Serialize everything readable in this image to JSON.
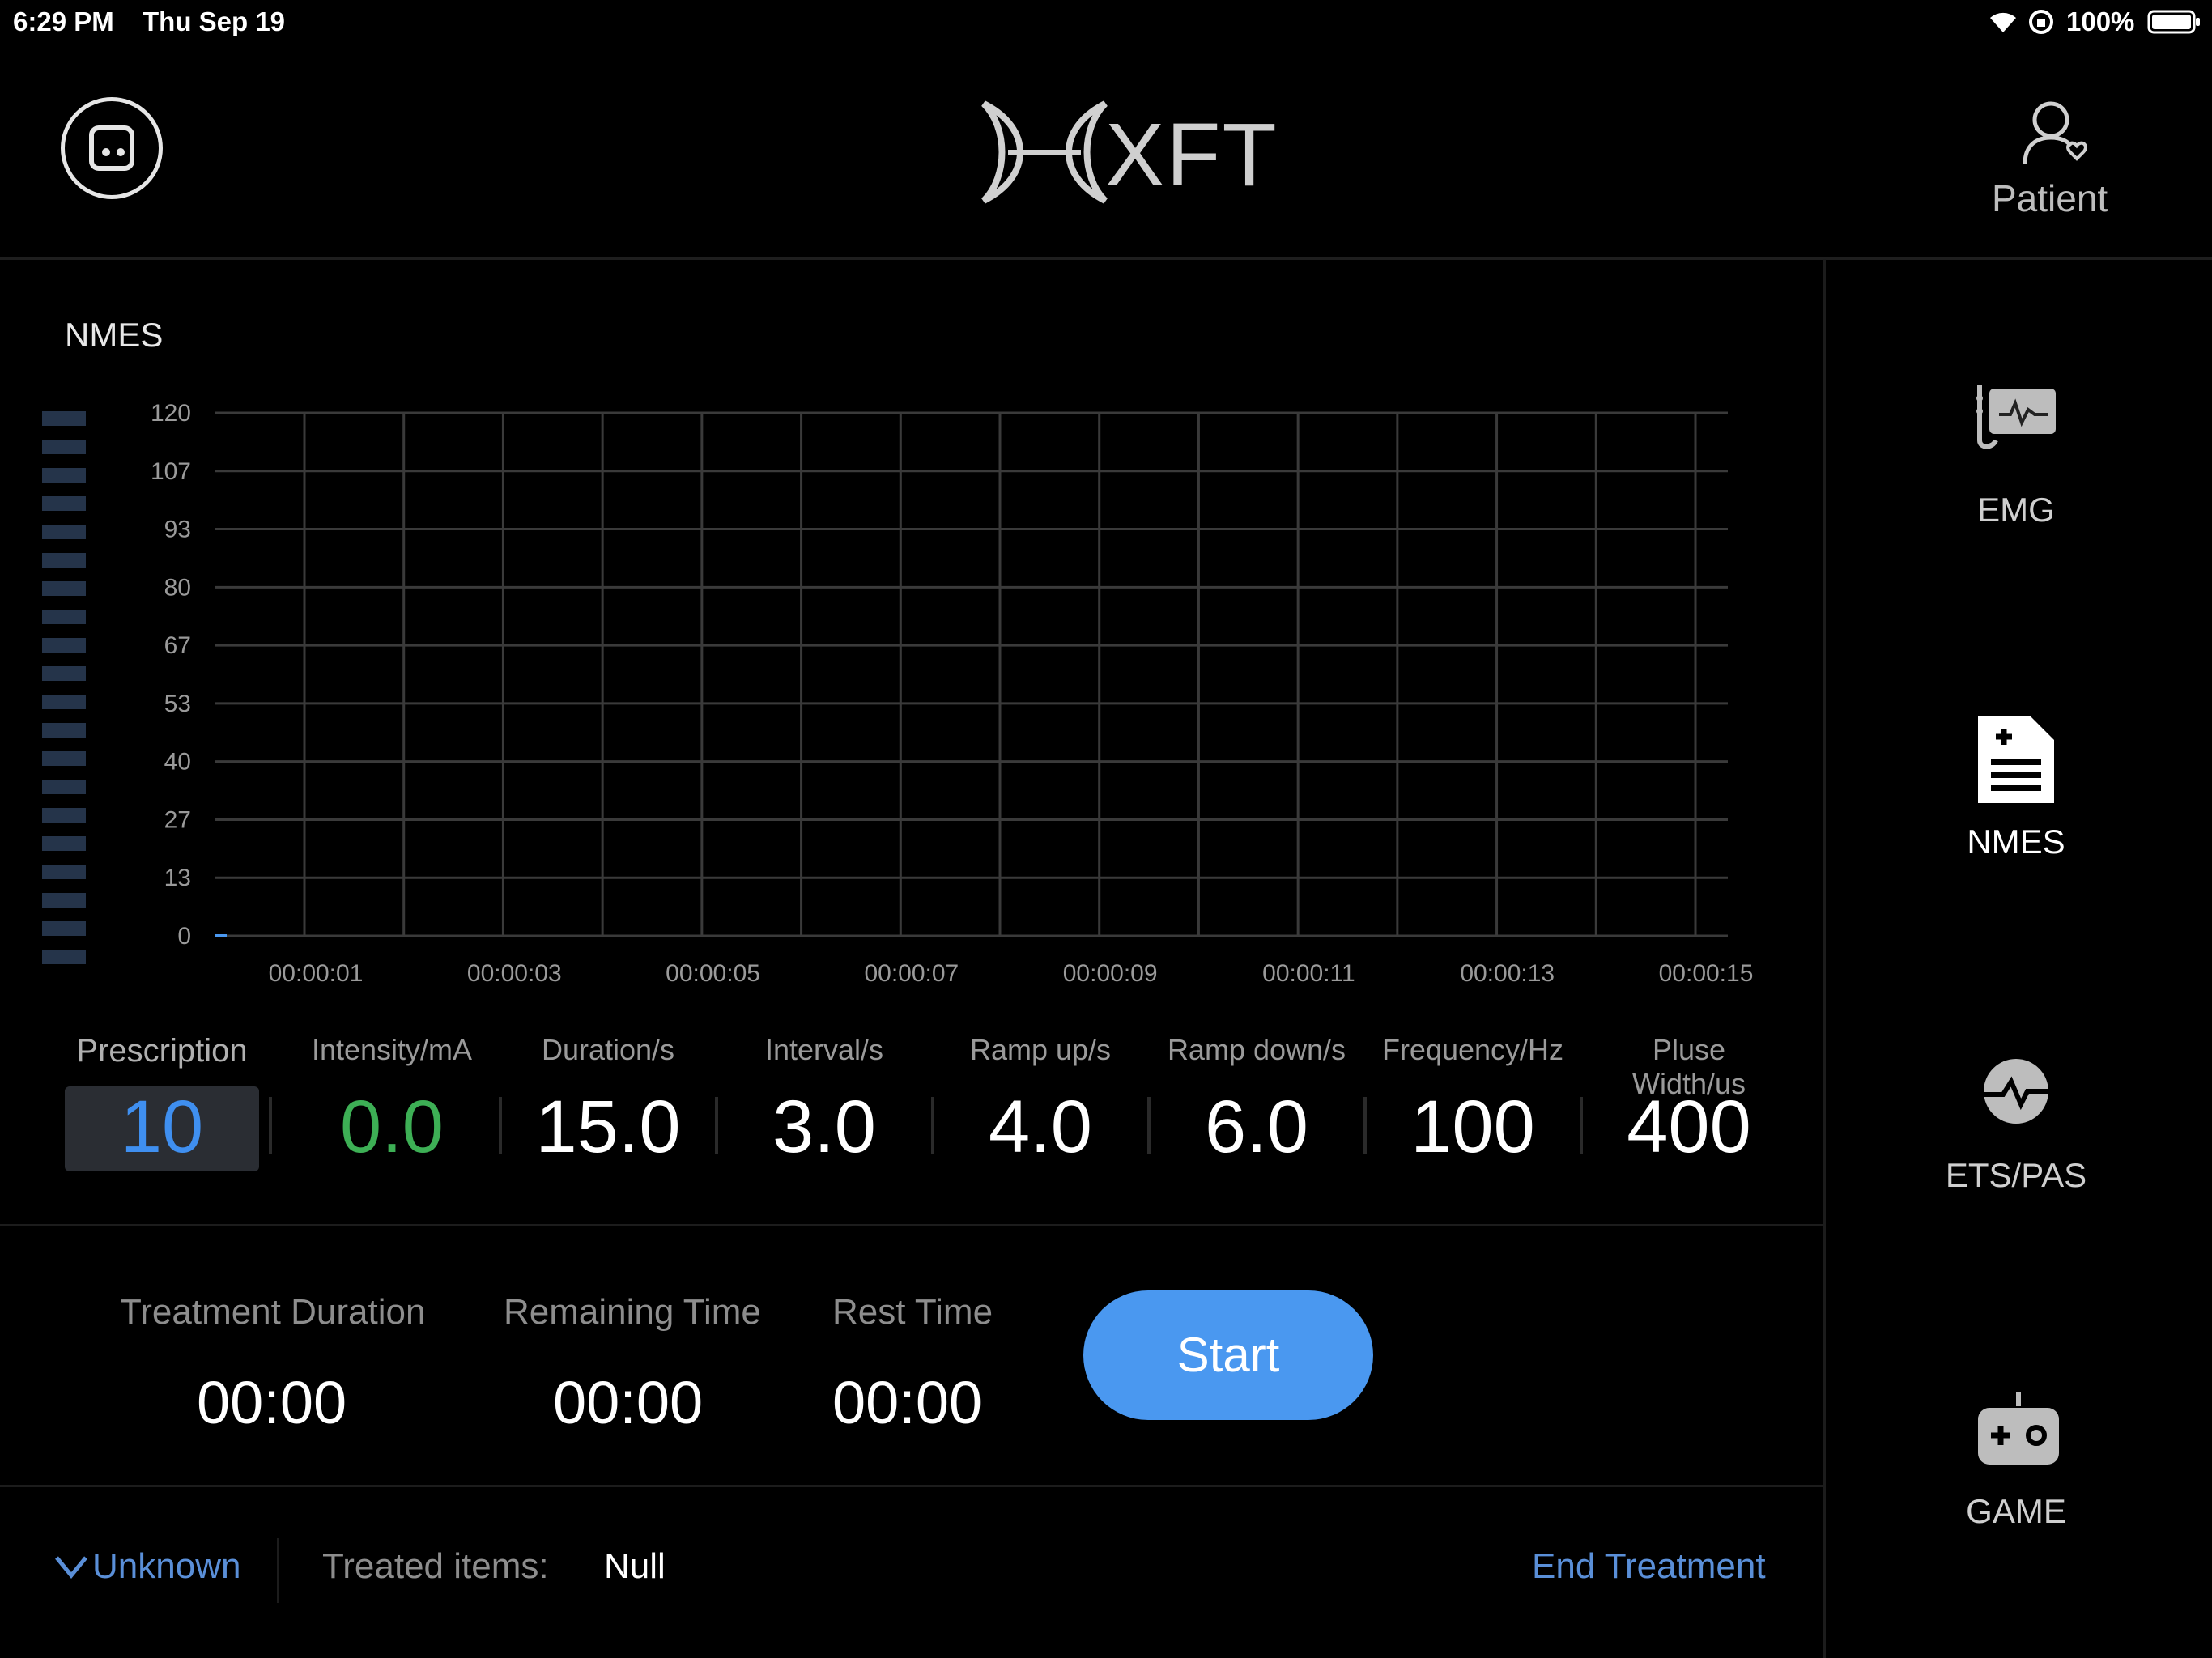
{
  "status_bar": {
    "time": "6:29 PM",
    "date": "Thu Sep 19",
    "battery": "100%"
  },
  "header": {
    "logo_text": "XFT",
    "patient_label": "Patient"
  },
  "panel": {
    "title": "NMES"
  },
  "chart_data": {
    "type": "line",
    "title": "",
    "xlabel": "",
    "ylabel": "",
    "y_ticks": [
      "120",
      "107",
      "93",
      "80",
      "67",
      "53",
      "40",
      "27",
      "13",
      "0"
    ],
    "x_ticks": [
      "00:00:01",
      "00:00:03",
      "00:00:05",
      "00:00:07",
      "00:00:09",
      "00:00:11",
      "00:00:13",
      "00:00:15"
    ],
    "ylim": [
      0,
      120
    ],
    "grid": true,
    "series": []
  },
  "params": {
    "labels": [
      "Prescription",
      "Intensity/mA",
      "Duration/s",
      "Interval/s",
      "Ramp up/s",
      "Ramp down/s",
      "Frequency/Hz",
      "Pluse Width/us"
    ],
    "values": [
      "10",
      "0.0",
      "15.0",
      "3.0",
      "4.0",
      "6.0",
      "100",
      "400"
    ]
  },
  "timers": {
    "treatment_duration_label": "Treatment Duration",
    "treatment_duration_value": "00:00",
    "remaining_label": "Remaining Time",
    "remaining_value": "00:00",
    "rest_label": "Rest Time",
    "rest_value": "00:00",
    "start_label": "Start"
  },
  "footer": {
    "unknown_label": "Unknown",
    "treated_items_label": "Treated items:",
    "treated_items_value": "Null",
    "end_treatment_label": "End Treatment"
  },
  "sidebar": {
    "items": [
      {
        "label": "EMG",
        "icon": "emg-icon"
      },
      {
        "label": "NMES",
        "icon": "document-plus-icon"
      },
      {
        "label": "ETS/PAS",
        "icon": "pulse-circle-icon"
      },
      {
        "label": "GAME",
        "icon": "gamepad-icon"
      }
    ]
  },
  "colors": {
    "accent_blue": "#4a98f0",
    "intensity_green": "#3daf55",
    "prescription_blue": "#3f8ff0",
    "link_blue": "#5a8fd8"
  }
}
